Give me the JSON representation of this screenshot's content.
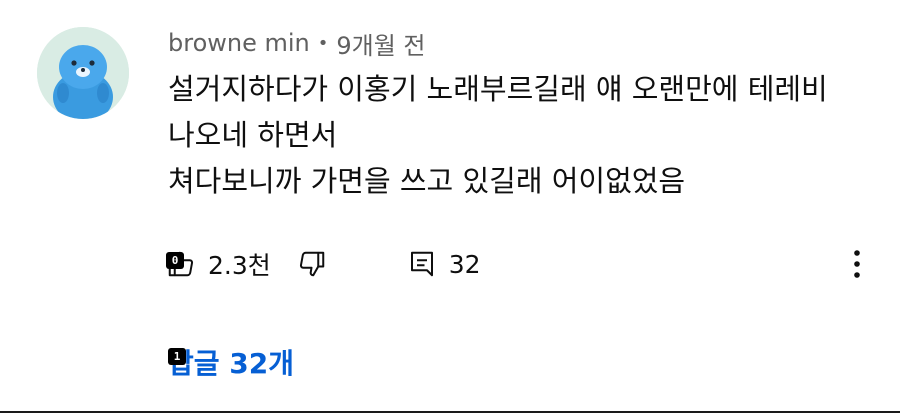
{
  "comment": {
    "author": "browne min",
    "separator": "•",
    "time": "9개월 전",
    "text_lines": [
      "설거지하다가 이홍기 노래부르길래 얘 오랜만에 테레비",
      "나오네 하면서",
      "쳐다보니까 가면을 쓰고 있길래 어이없었음"
    ],
    "likes": "2.3천",
    "reply_count": "32",
    "replies_link": "답글 32개"
  },
  "markers": [
    "0",
    "1"
  ],
  "icons": {
    "like": "thumb-up-icon",
    "dislike": "thumb-down-icon",
    "reply": "comment-icon",
    "more": "more-vertical-icon"
  },
  "colors": {
    "link": "#065fd4",
    "meta": "#606060",
    "text": "#0f0f0f",
    "avatar_bg": "#d9ece4",
    "avatar_char": "#3a9be0"
  }
}
